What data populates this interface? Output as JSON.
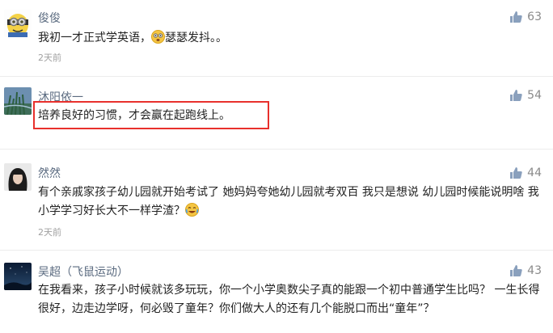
{
  "comments": [
    {
      "author": "俊俊",
      "text": "我初一才正式学英语，",
      "text_after_emoji": "瑟瑟发抖。。",
      "emoji": "scared-face-icon",
      "time": "2天前",
      "likes": "63"
    },
    {
      "author": "沐阳依一",
      "text": "培养良好的习惯，才会赢在起跑线上。",
      "time": "",
      "likes": "54"
    },
    {
      "author": "然然",
      "text": "有个亲戚家孩子幼儿园就开始考试了 她妈妈夸她幼儿园就考双百 我只是想说 幼儿园时候能说明啥 我小学学习好长大不一样学渣？",
      "emoji": "crying-laughing-face-icon",
      "time": "2天前",
      "likes": "44"
    },
    {
      "author": "吴超（飞鼠运动）",
      "text": "在我看来，孩子小时候就该多玩玩，你一个小学奥数尖子真的能跟一个初中普通学生比吗？ 一生长得很好，边走边学呀，何必毁了童年？你们做大人的还有几个能脱口而出“童年”？",
      "time": "",
      "likes": "43"
    }
  ],
  "colors": {
    "author": "#5b6b80",
    "highlight_border": "#e8302c",
    "timestamp": "#a0a0a0"
  }
}
